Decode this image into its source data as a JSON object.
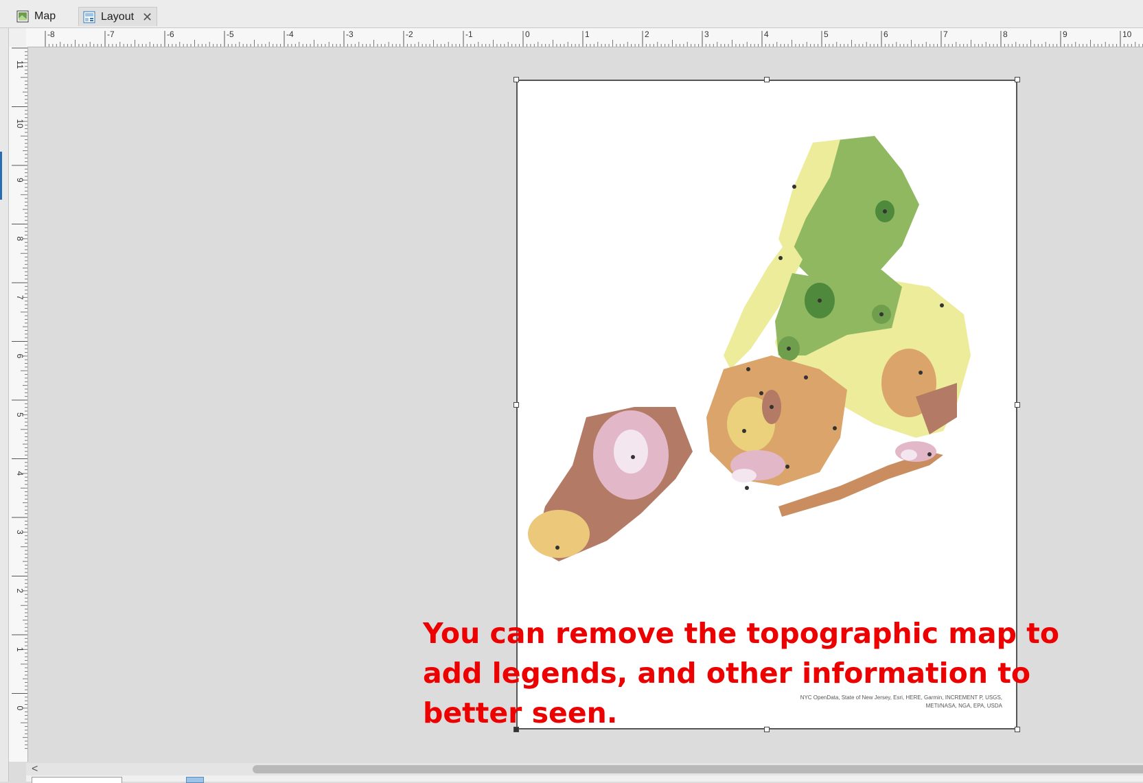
{
  "tabs": [
    {
      "label": "Map",
      "icon": "map-icon",
      "active": false
    },
    {
      "label": "Layout",
      "icon": "layout-icon",
      "active": true,
      "closable": true
    }
  ],
  "rulers": {
    "horizontal": [
      "-8",
      "-7",
      "-6",
      "-5",
      "-4",
      "-3",
      "-2",
      "-1",
      "0",
      "1",
      "2",
      "3",
      "4",
      "5",
      "6",
      "7",
      "8",
      "9",
      "10"
    ],
    "vertical": [
      "11",
      "10",
      "9",
      "8",
      "7",
      "6",
      "5",
      "4",
      "3",
      "2",
      "1",
      "0"
    ]
  },
  "layout_page": {
    "credits_line1": "NYC OpenData, State of New Jersey, Esri, HERE, Garmin, INCREMENT P, USGS,",
    "credits_line2": "METI/NASA, NGA, EPA, USDA"
  },
  "annotation": {
    "text": "You can remove the topographic map to add legends, and other information to better seen.",
    "color": "#ec0000"
  },
  "colors": {
    "canvas": "#dcdcdc",
    "legend_green_dark": "#4f8a3c",
    "legend_green": "#8fb860",
    "legend_yellow": "#ecec9a",
    "legend_orange": "#dba46a",
    "legend_brown": "#b37a66",
    "legend_pink": "#e2b8c8"
  }
}
